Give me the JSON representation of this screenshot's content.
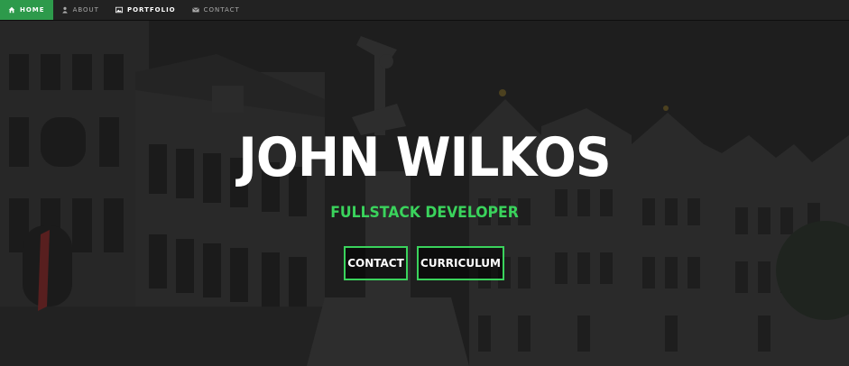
{
  "nav": {
    "items": [
      {
        "label": "HOME",
        "icon": "home-icon"
      },
      {
        "label": "ABOUT",
        "icon": "user-icon"
      },
      {
        "label": "PORTFOLIO",
        "icon": "image-icon"
      },
      {
        "label": "CONTACT",
        "icon": "envelope-icon"
      }
    ]
  },
  "hero": {
    "name": "JOHN WILKOS",
    "role": "FULLSTACK DEVELOPER",
    "buttons": {
      "contact": "CONTACT",
      "curriculum": "CURRICULUM"
    }
  },
  "colors": {
    "accent": "#3ad35c",
    "nav_active": "#2d9a4b",
    "nav_bg": "#222222"
  }
}
